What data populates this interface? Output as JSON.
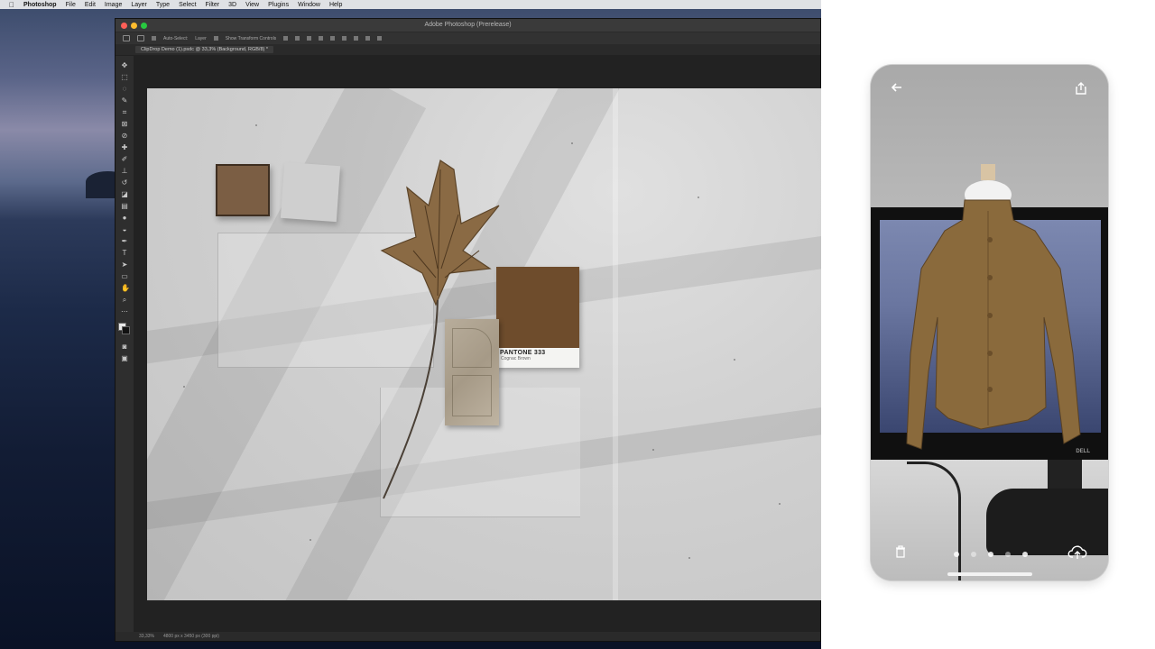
{
  "menubar": {
    "apple": "",
    "items": [
      "Photoshop",
      "File",
      "Edit",
      "Image",
      "Layer",
      "Type",
      "Select",
      "Filter",
      "3D",
      "View",
      "Plugins",
      "Window",
      "Help"
    ]
  },
  "photoshop": {
    "window_title": "Adobe Photoshop (Prerelease)",
    "options_bar": {
      "auto_select": "Auto-Select:",
      "layer_select": "Layer",
      "show_transform": "Show Transform Controls"
    },
    "document_tab": "ClipDrop Demo (1).psdc @ 33,3% (Background, RGB/8) *",
    "status_zoom": "33,33%",
    "status_info": "4800 px x 3450 px (300 ppi)"
  },
  "canvas": {
    "pantone_code": "PANTONE 333",
    "pantone_name": "Cognac Brown"
  },
  "phone": {
    "monitor_brand": "DELL",
    "page_dots": 5,
    "active_dot": 1
  },
  "colors": {
    "desktop_top": "#3a4a6a",
    "ps_chrome": "#222222",
    "canvas_bg": "#d2d2d2",
    "pantone_brown": "#6e4c2c",
    "jacket": "#8a6a3c"
  }
}
